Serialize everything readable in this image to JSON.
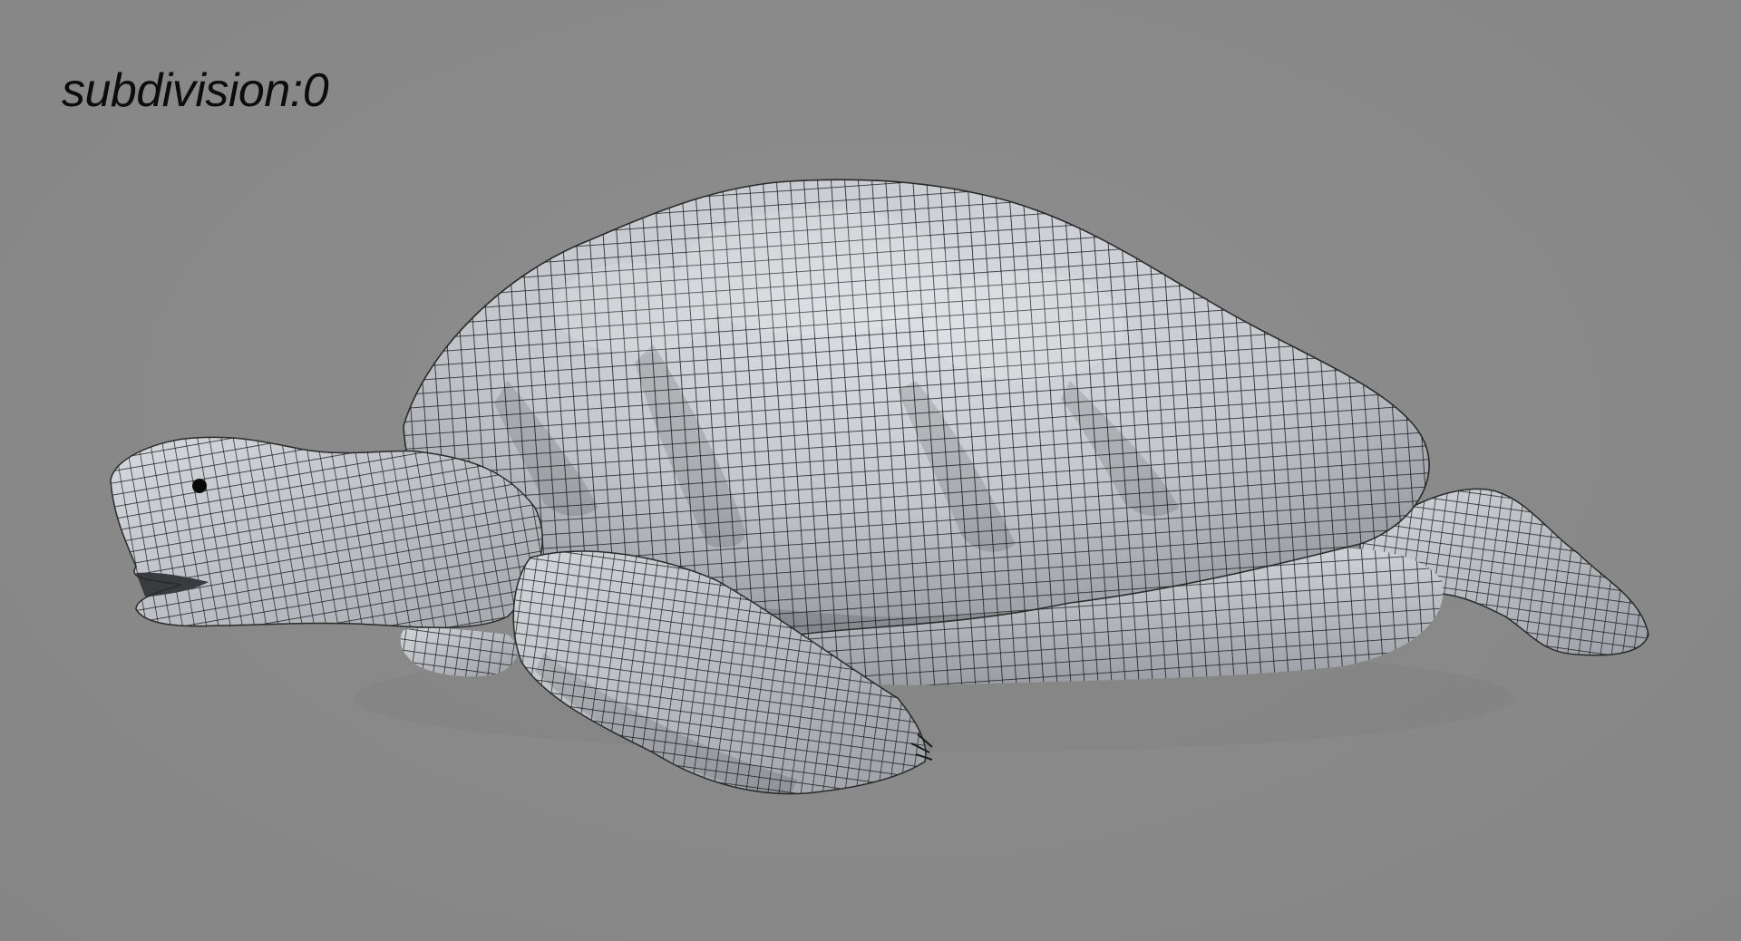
{
  "viewport": {
    "caption": "subdivision:0",
    "background_color": "#898989"
  },
  "model": {
    "subject": "tortoise",
    "display_mode": "wireframe-on-shaded",
    "surface_color": "#c9ccd1",
    "wire_color": "#1b1b1b"
  }
}
